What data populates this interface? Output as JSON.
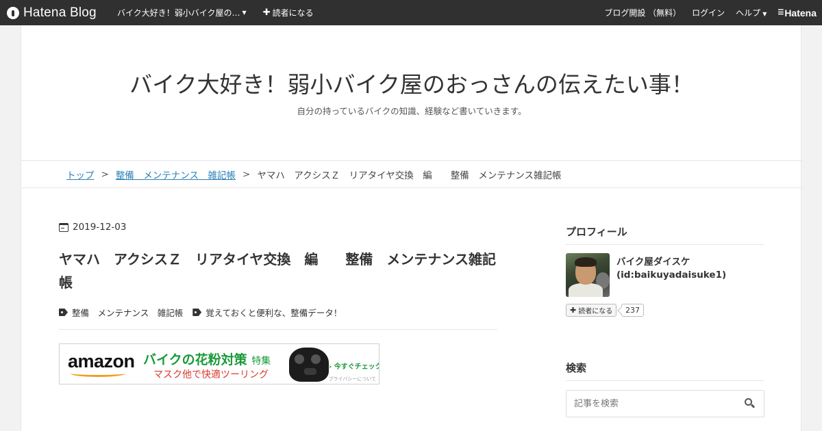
{
  "navbar": {
    "logo_text": "Hatena Blog",
    "blog_menu_label": "バイク大好き！弱小バイク屋の…",
    "subscribe_label": "読者になる",
    "blog_open_label": "ブログ開設 （無料）",
    "login_label": "ログイン",
    "help_label": "ヘルプ",
    "hatena_label": "Hatena"
  },
  "blog": {
    "title": "バイク大好き！弱小バイク屋のおっさんの伝えたい事！",
    "description": "自分の持っているバイクの知識、経験など書いていきます。"
  },
  "breadcrumb": {
    "top": "トップ",
    "sep": ">",
    "category": "整備　メンテナンス　雑記帳",
    "current": "ヤマハ　アクシスＺ　リアタイヤ交換　編　　整備　メンテナンス雑記帳"
  },
  "entry": {
    "date": "2019-12-03",
    "title": "ヤマハ　アクシスＺ　リアタイヤ交換　編　　整備　メンテナンス雑記帳",
    "categories": [
      "整備　メンテナンス　雑記帳",
      "覚えておくと便利な、整備データ！"
    ]
  },
  "ad": {
    "logo": "amazon",
    "headline": "バイクの花粉対策",
    "headline_suffix": "特集",
    "subline": "マスク他で快適ツーリング",
    "cta": "› 今すぐチェック",
    "privacy": "プライバシーについて",
    "colors": {
      "headline": "#1a9a3a",
      "subline": "#d83a2e",
      "smile": "#f29d22"
    }
  },
  "sidebar": {
    "profile_heading": "プロフィール",
    "profile_name": "バイク屋ダイスケ",
    "profile_id": "(id:baikuyadaisuke1)",
    "subscribe_label": "読者になる",
    "subscriber_count": "237",
    "search_heading": "検索",
    "search_placeholder": "記事を検索"
  },
  "colors": {
    "navbar_bg": "#303030",
    "link": "#2a7fb8",
    "page_bg": "#f2f2f2"
  }
}
